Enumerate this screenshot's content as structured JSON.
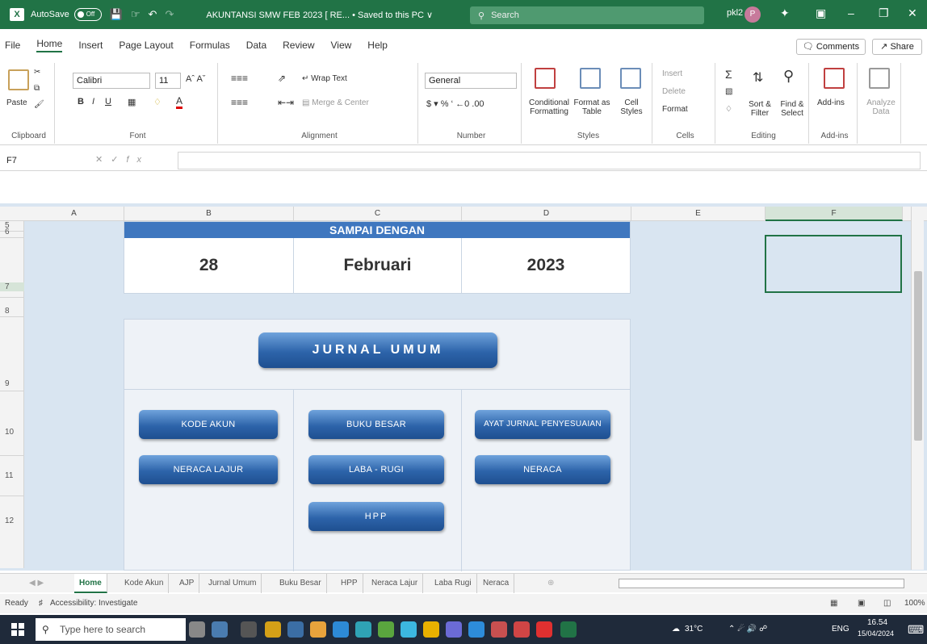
{
  "titlebar": {
    "autosave": "AutoSave",
    "autosave_state": "Off",
    "doc_title": "AKUNTANSI SMW FEB 2023 [ RE... • Saved to this PC ∨",
    "search_placeholder": "Search",
    "user": "pkl2"
  },
  "menu": {
    "tabs": [
      "File",
      "Home",
      "Insert",
      "Page Layout",
      "Formulas",
      "Data",
      "Review",
      "View",
      "Help"
    ],
    "comments": "Comments",
    "share": "Share"
  },
  "ribbon": {
    "paste": "Paste",
    "font_name": "Calibri",
    "font_size": "11",
    "wrap_text": "Wrap Text",
    "merge_center": "Merge & Center",
    "number_format": "General",
    "conditional_formatting": "Conditional Formatting",
    "format_as_table": "Format as Table",
    "cell_styles": "Cell Styles",
    "insert": "Insert",
    "delete": "Delete",
    "format": "Format",
    "sort_filter": "Sort & Filter",
    "find_select": "Find & Select",
    "add_ins": "Add-ins",
    "analyze_data": "Analyze Data",
    "groups": [
      "Clipboard",
      "Font",
      "Alignment",
      "Number",
      "Styles",
      "Cells",
      "Editing",
      "Add-ins"
    ]
  },
  "formula_bar": {
    "name_box": "F7",
    "formula": ""
  },
  "columns": [
    "A",
    "B",
    "C",
    "D",
    "E",
    "F"
  ],
  "rows": [
    "5",
    "6",
    "7",
    "8",
    "9",
    "10",
    "11",
    "12"
  ],
  "sheet_content": {
    "banner": "SAMPAI DENGAN",
    "day": "28",
    "month": "Februari",
    "year": "2023",
    "main_button": "JURNAL UMUM",
    "buttons": {
      "kode_akun": "KODE AKUN",
      "neraca_lajur": "NERACA LAJUR",
      "buku_besar": "BUKU BESAR",
      "laba_rugi": "LABA - RUGI",
      "hpp": "HPP",
      "ajp": "AYAT JURNAL PENYESUAIAN",
      "neraca": "NERACA"
    }
  },
  "sheet_tabs": [
    "Home",
    "Kode Akun",
    "AJP",
    "Jurnal Umum",
    "Buku Besar",
    "HPP",
    "Neraca Lajur",
    "Laba Rugi",
    "Neraca"
  ],
  "status": {
    "ready": "Ready",
    "accessibility": "Accessibility: Investigate",
    "zoom": "100%"
  },
  "taskbar": {
    "search": "Type here to search",
    "temp": "31°C",
    "lang": "ENG",
    "time": "16.54",
    "date": "15/04/2024"
  }
}
